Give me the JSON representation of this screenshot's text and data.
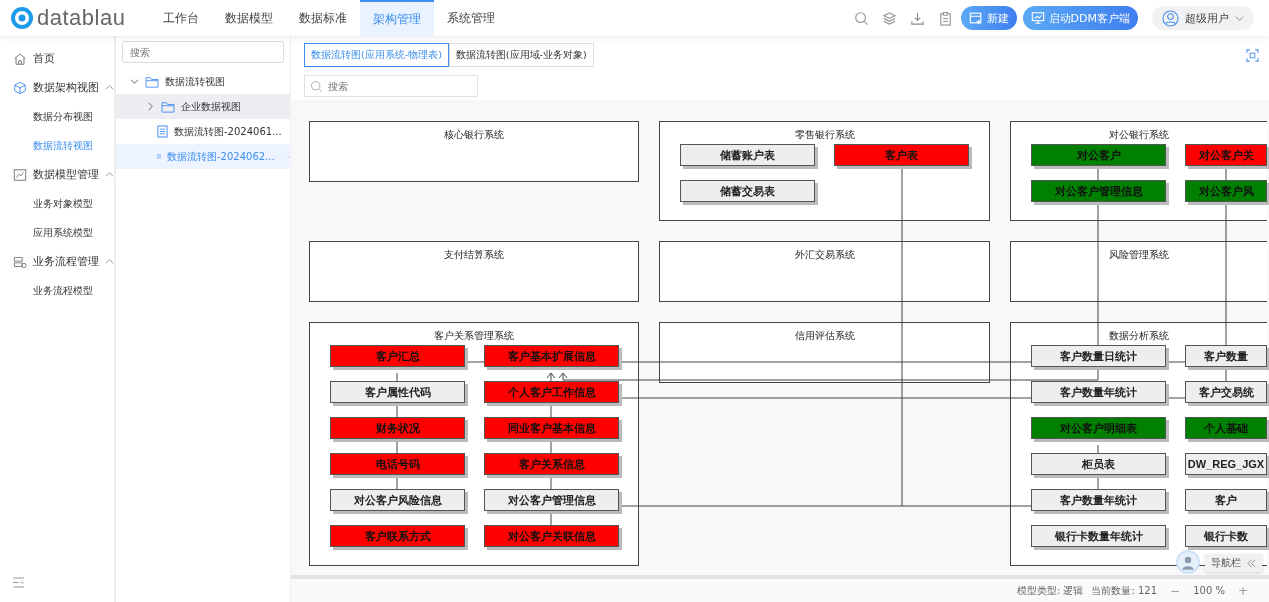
{
  "brand": {
    "name": "datablau"
  },
  "top_nav": [
    {
      "label": "工作台",
      "selected": false
    },
    {
      "label": "数据模型",
      "selected": false
    },
    {
      "label": "数据标准",
      "selected": false
    },
    {
      "label": "架构管理",
      "selected": true
    },
    {
      "label": "系统管理",
      "selected": false
    }
  ],
  "header_actions": {
    "new_button": "新建",
    "client_button": "启动DDM客户端",
    "user": "超级用户"
  },
  "sidebar": {
    "items": [
      {
        "label": "首页",
        "kind": "link",
        "selected": false
      },
      {
        "label": "数据架构视图",
        "kind": "group",
        "expanded": true,
        "children": [
          {
            "label": "数据分布视图",
            "selected": false
          },
          {
            "label": "数据流转视图",
            "selected": true
          }
        ]
      },
      {
        "label": "数据模型管理",
        "kind": "group",
        "expanded": true,
        "children": [
          {
            "label": "业务对象模型",
            "selected": false
          },
          {
            "label": "应用系统模型",
            "selected": false
          }
        ]
      },
      {
        "label": "业务流程管理",
        "kind": "group",
        "expanded": true,
        "children": [
          {
            "label": "业务流程模型",
            "selected": false
          }
        ]
      }
    ]
  },
  "tree": {
    "search": {
      "placeholder": "搜索"
    },
    "items": [
      {
        "label": "数据流转视图",
        "kind": "folder",
        "expanded": true,
        "selected": false,
        "children": [
          {
            "label": "企业数据视图",
            "kind": "folder",
            "expanded": false,
            "selected": false,
            "hovered": true
          },
          {
            "label": "数据流转图-2024061...",
            "kind": "file",
            "selected": false
          },
          {
            "label": "数据流转图-2024062...",
            "kind": "file",
            "selected": true
          }
        ]
      }
    ]
  },
  "tabs": [
    {
      "label": "数据流转图(应用系统-物理表)",
      "selected": true
    },
    {
      "label": "数据流转图(应用域-业务对象)",
      "selected": false
    }
  ],
  "search": {
    "placeholder": "搜索"
  },
  "diagram": {
    "systems": [
      {
        "name": "核心银行系统"
      },
      {
        "name": "零售银行系统",
        "tables": [
          {
            "name": "储蓄账户表",
            "color": "#eeeeee"
          },
          {
            "name": "客户表",
            "color": "#ff0000"
          },
          {
            "name": "储蓄交易表",
            "color": "#eeeeee"
          }
        ]
      },
      {
        "name": "对公银行系统",
        "tables": [
          {
            "name": "对公客户",
            "color": "#008000"
          },
          {
            "name": "对公客户关",
            "color": "#ff0000"
          },
          {
            "name": "对公客户管理信息",
            "color": "#008000"
          },
          {
            "name": "对公客户风",
            "color": "#008000"
          }
        ]
      },
      {
        "name": "支付结算系统"
      },
      {
        "name": "外汇交易系统"
      },
      {
        "name": "风险管理系统"
      },
      {
        "name": "客户关系管理系统",
        "tables": [
          {
            "name": "客户汇总",
            "color": "#ff0000"
          },
          {
            "name": "客户基本扩展信息",
            "color": "#ff0000"
          },
          {
            "name": "客户属性代码",
            "color": "#eeeeee"
          },
          {
            "name": "个人客户工作信息",
            "color": "#ff0000"
          },
          {
            "name": "财务状况",
            "color": "#ff0000"
          },
          {
            "name": "同业客户基本信息",
            "color": "#ff0000"
          },
          {
            "name": "电话号码",
            "color": "#ff0000"
          },
          {
            "name": "客户关系信息",
            "color": "#ff0000"
          },
          {
            "name": "对公客户风险信息",
            "color": "#eeeeee"
          },
          {
            "name": "对公客户管理信息",
            "color": "#eeeeee"
          },
          {
            "name": "客户联系方式",
            "color": "#ff0000"
          },
          {
            "name": "对公客户关联信息",
            "color": "#ff0000"
          }
        ]
      },
      {
        "name": "信用评估系统"
      },
      {
        "name": "数据分析系统",
        "tables": [
          {
            "name": "客户数量日统计",
            "color": "#eeeeee"
          },
          {
            "name": "客户数量",
            "color": "#eeeeee"
          },
          {
            "name": "客户数量年统计",
            "color": "#eeeeee"
          },
          {
            "name": "客户交易统",
            "color": "#eeeeee"
          },
          {
            "name": "对公客户明细表",
            "color": "#008000"
          },
          {
            "name": "个人基础",
            "color": "#008000"
          },
          {
            "name": "柜员表",
            "color": "#eeeeee"
          },
          {
            "name": "DW_REG_JGX",
            "color": "#eeeeee"
          },
          {
            "name": "客户数量年统计",
            "color": "#eeeeee"
          },
          {
            "name": "客户",
            "color": "#eeeeee"
          },
          {
            "name": "银行卡数量年统计",
            "color": "#eeeeee"
          },
          {
            "name": "银行卡数",
            "color": "#eeeeee"
          }
        ]
      }
    ]
  },
  "nav_panel": {
    "label": "导航栏"
  },
  "status_bar": {
    "model_type": "模型类型: 逻辑",
    "count": "当前数量: 121",
    "zoom_out": "−",
    "zoom": "100 %",
    "zoom_in": "+"
  }
}
